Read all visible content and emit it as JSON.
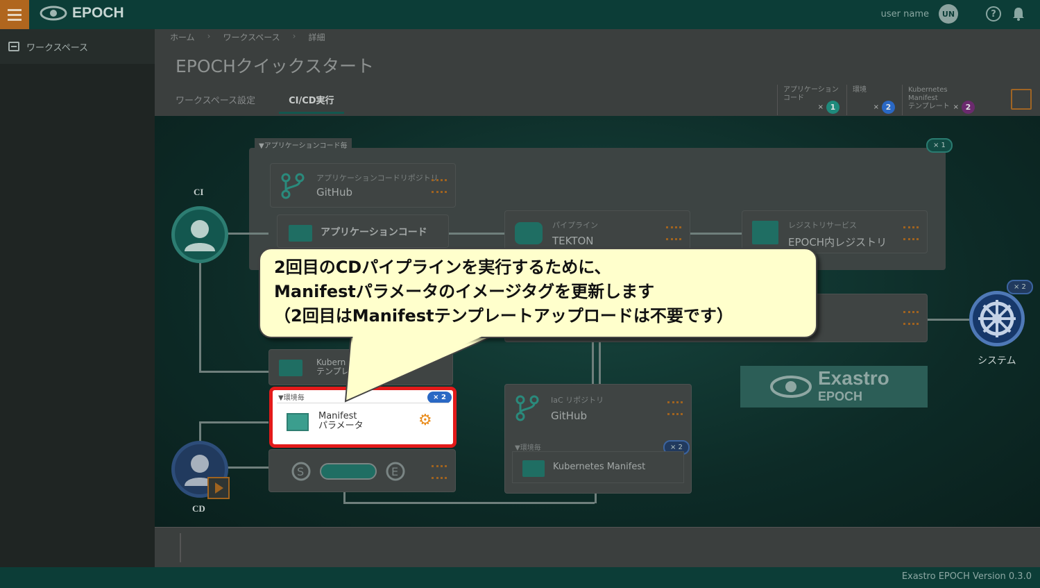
{
  "header": {
    "app_name": "EPOCH",
    "user_name": "user name",
    "user_initials": "UN",
    "help_icon": "question-mark-circle-icon",
    "bell_icon": "bell-icon"
  },
  "sidebar": {
    "items": [
      {
        "label": "ワークスペース",
        "icon": "workspace-icon"
      }
    ]
  },
  "breadcrumb": [
    "ホーム",
    "ワークスペース",
    "詳細"
  ],
  "page": {
    "title": "EPOCHクイックスタート",
    "tabs": [
      {
        "label": "ワークスペース設定",
        "active": false
      },
      {
        "label": "CI/CD実行",
        "active": true
      }
    ]
  },
  "counts": [
    {
      "label": "アプリケーション\nコード",
      "value": "1",
      "color": "#1f8a7c"
    },
    {
      "label": "環境",
      "value": "2",
      "color": "#2a68c4"
    },
    {
      "label": "Kubernetes Manifest\nテンプレート",
      "value": "2",
      "color": "#6b2a6e"
    }
  ],
  "canvas": {
    "group_label": "▼アプリケーションコード毎",
    "group_count": "× 1",
    "ci_label": "CI",
    "cd_label": "CD",
    "system_label": "システム",
    "system_count": "× 2",
    "cards": {
      "app_repo": {
        "sub": "アプリケーションコードリポジトリ",
        "main": "GitHub"
      },
      "app_code": {
        "main": "アプリケーションコード"
      },
      "pipeline": {
        "sub": "パイプライン",
        "main": "TEKTON"
      },
      "registry": {
        "sub": "レジストリサービス",
        "main": "EPOCH内レジストリ"
      },
      "k8s_template": {
        "main": "Kubern\nテンプレ"
      },
      "iac_repo": {
        "sub": "IaC リポジトリ",
        "main": "GitHub"
      },
      "k8s_manifest": {
        "label": "▼環境毎",
        "main": "Kubernetes Manifest",
        "count": "× 2"
      },
      "cd_pipeline": {
        "s": "S",
        "e": "E"
      }
    },
    "manifest_param": {
      "label": "▼環境毎",
      "title": "Manifest\nパラメータ",
      "count": "× 2",
      "gear_icon": "gear-icon"
    },
    "exastro": {
      "line1": "Exastro",
      "line2": "EPOCH"
    }
  },
  "callout": {
    "text": "2回目のCDパイプラインを実行するために、\nManifestパラメータのイメージタグを更新します\n（2回目はManifestテンプレートアップロードは不要です）"
  },
  "footer": {
    "version": "Exastro EPOCH Version 0.3.0"
  }
}
